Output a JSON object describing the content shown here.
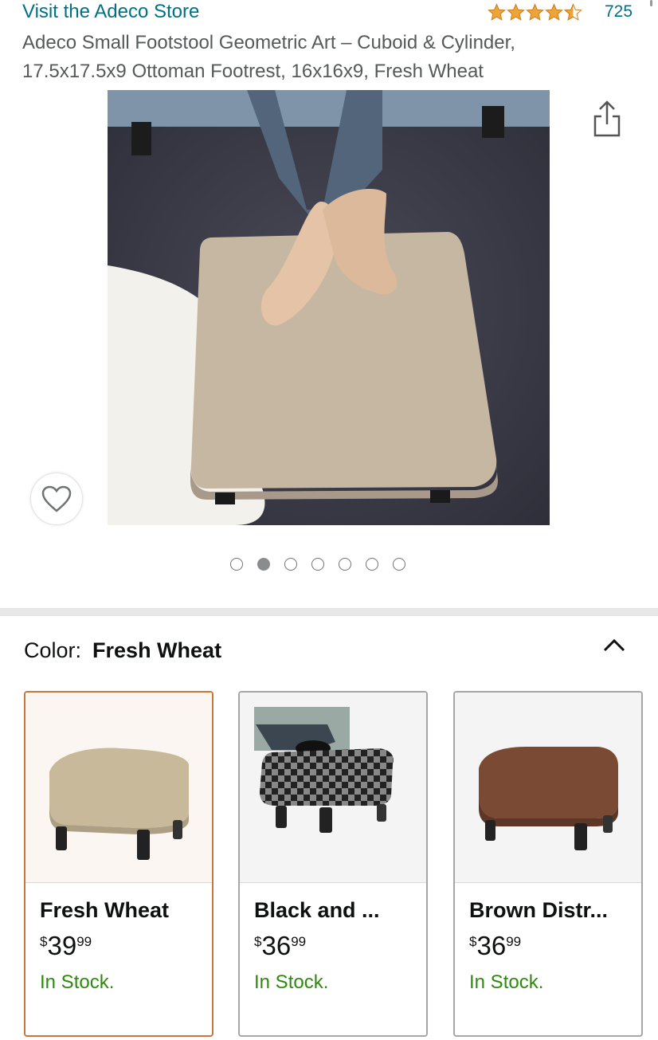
{
  "header": {
    "store_link": "Visit the Adeco Store",
    "rating": {
      "stars": 4.5,
      "count": "725"
    },
    "title": "Adeco Small Footstool Geometric Art – Cuboid & Cylinder, 17.5x17.5x9 Ottoman Footrest, 16x16x9, Fresh Wheat"
  },
  "gallery": {
    "icons": {
      "share": "share-icon",
      "wishlist": "heart-icon"
    },
    "dot_count": 7,
    "active_dot": 2
  },
  "variation": {
    "label": "Color:",
    "selected": "Fresh Wheat",
    "options": [
      {
        "name": "Fresh Wheat",
        "currency": "$",
        "whole": "39",
        "fraction": "99",
        "stock": "In Stock."
      },
      {
        "name": "Black and ...",
        "currency": "$",
        "whole": "36",
        "fraction": "99",
        "stock": "In Stock."
      },
      {
        "name": "Brown Distr...",
        "currency": "$",
        "whole": "36",
        "fraction": "99",
        "stock": "In Stock."
      }
    ]
  },
  "colors": {
    "link": "#007185",
    "star": "#f0a33a",
    "in_stock": "#2d8a0e",
    "selected_border": "#c9773b"
  }
}
